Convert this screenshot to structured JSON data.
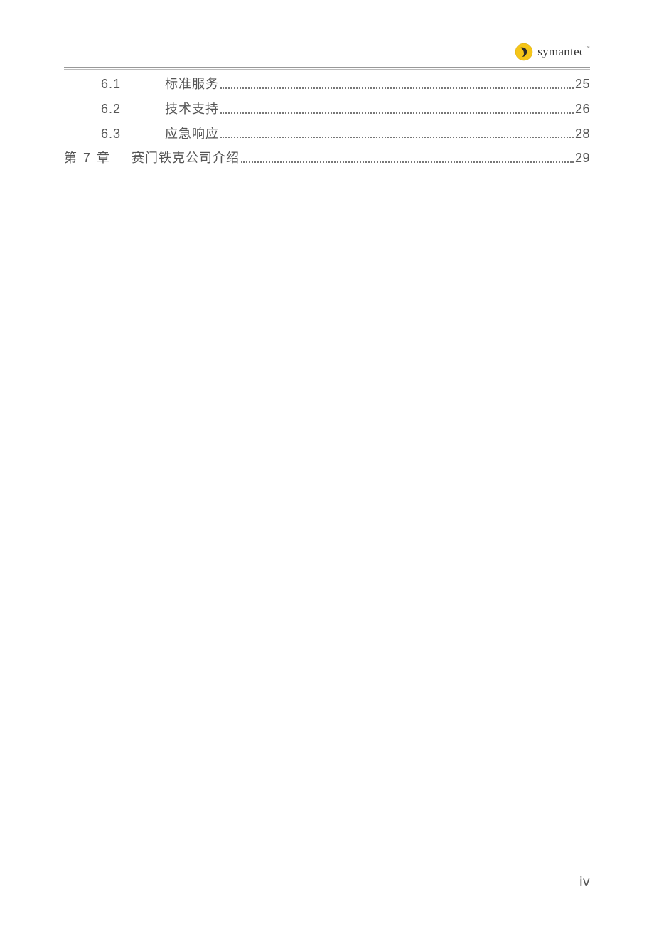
{
  "header": {
    "brand_text": "symantec",
    "brand_tm": "™"
  },
  "toc": {
    "entries": [
      {
        "type": "subsection",
        "number": "6.1",
        "title": "标准服务",
        "page": "25"
      },
      {
        "type": "subsection",
        "number": "6.2",
        "title": "技术支持",
        "page": "26"
      },
      {
        "type": "subsection",
        "number": "6.3",
        "title": "应急响应",
        "page": "28"
      },
      {
        "type": "chapter",
        "number": "第 7 章",
        "title": "赛门铁克公司介绍",
        "page": "29"
      }
    ]
  },
  "footer": {
    "page_number": "iv"
  }
}
